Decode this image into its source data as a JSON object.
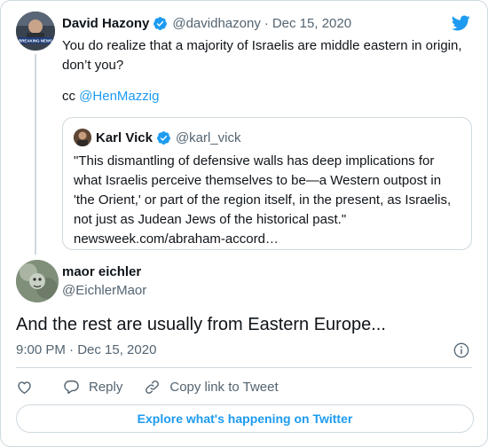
{
  "parent_tweet": {
    "author_name": "David Hazony",
    "handle": "@davidhazony",
    "separator": "·",
    "date": "Dec 15, 2020",
    "text": "You do realize that a majority of Israelis are middle eastern in origin, don’t you?",
    "cc_prefix": "cc ",
    "cc_mention": "@HenMazzig",
    "avatar_caption": "BREAKING NEWS"
  },
  "quoted_tweet": {
    "author_name": "Karl Vick",
    "handle": "@karl_vick",
    "text": "\"This dismantling of defensive walls has deep implications for what Israelis perceive themselves to be—a Western outpost in 'the Orient,' or part of the region itself, in the present, as Israelis, not just as Judean Jews of the historical past.\" newsweek.com/abraham-accord…"
  },
  "main_tweet": {
    "author_name": "maor eichler",
    "handle": "@EichlerMaor",
    "text": "And the rest are usually from Eastern Europe...",
    "timestamp": "9:00 PM · Dec 15, 2020"
  },
  "actions": {
    "reply_label": "Reply",
    "copy_label": "Copy link to Tweet"
  },
  "explore_label": "Explore what's happening on Twitter",
  "icons": {
    "brand": "twitter-bird-icon",
    "verified": "verified-badge-icon",
    "like": "heart-icon",
    "reply": "speech-bubble-icon",
    "copy": "link-icon",
    "info": "info-icon"
  },
  "colors": {
    "accent": "#1d9bf0",
    "text_primary": "#0f1419",
    "text_secondary": "#536471",
    "border": "#cfd9de"
  }
}
